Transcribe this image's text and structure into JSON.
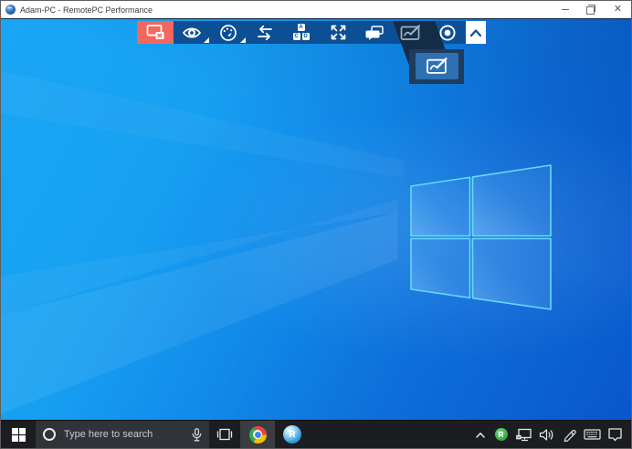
{
  "window": {
    "title": "Adam-PC - RemotePC Performance",
    "controls": {
      "minimize": "minimize",
      "restore": "restore",
      "close": "close"
    }
  },
  "session_toolbar": {
    "background_color": "#0d4f94",
    "disconnect_color": "#f2685c",
    "selected_color": "#132c47",
    "buttons": [
      {
        "icon": "disconnect-session-icon"
      },
      {
        "icon": "view-options-icon",
        "has_dropdown": true
      },
      {
        "icon": "performance-icon",
        "has_dropdown": true
      },
      {
        "icon": "file-transfer-icon"
      },
      {
        "icon": "shortcut-blocks-icon",
        "letters": [
          "A",
          "C",
          "D"
        ]
      },
      {
        "icon": "fullscreen-icon"
      },
      {
        "icon": "chat-icon"
      },
      {
        "icon": "whiteboard-icon",
        "selected": true
      },
      {
        "icon": "record-icon"
      },
      {
        "icon": "collapse-toolbar-icon"
      }
    ],
    "flyout": {
      "icon": "whiteboard-pen-icon",
      "button_color": "#2f70b2",
      "panel_color": "#1e3c5e"
    }
  },
  "desktop": {
    "wallpaper": "windows-10-light-logo",
    "logo_stroke_color": "#64d9fd",
    "base_colors": [
      "#1aa6f4",
      "#0a55ca"
    ]
  },
  "taskbar": {
    "background_color": "#1b1d20",
    "search": {
      "placeholder": "Type here to search"
    },
    "apps": [
      {
        "name": "chrome",
        "active": true
      },
      {
        "name": "remotepc",
        "active": false
      }
    ],
    "tray": [
      "hidden-icons-chevron",
      "remotepc-status",
      "network",
      "volume",
      "windows-ink",
      "touch-keyboard",
      "action-center"
    ]
  }
}
